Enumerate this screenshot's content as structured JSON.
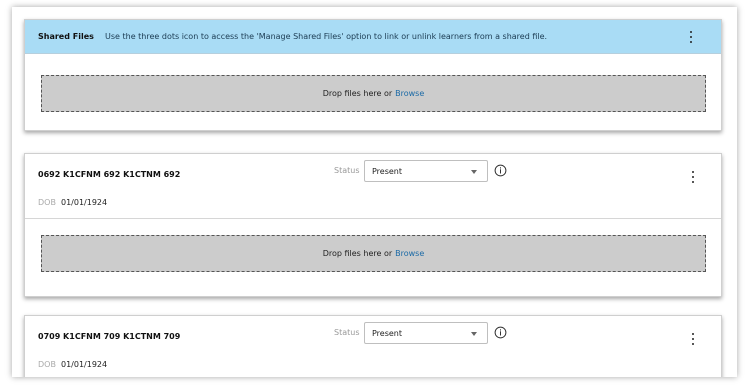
{
  "shared_files": {
    "title": "Shared Files",
    "info": "Use the three dots icon to access the 'Manage Shared Files' option to link or unlink learners from a shared file.",
    "drop_text": "Drop files here or",
    "browse_label": "Browse"
  },
  "learners": [
    {
      "name": "0692 K1CFNM 692 K1CTNM 692",
      "dob_label": "DOB",
      "dob": "01/01/1924",
      "status_label": "Status",
      "status": "Present",
      "drop_text": "Drop files here or",
      "browse_label": "Browse"
    },
    {
      "name": "0709 K1CFNM 709 K1CTNM 709",
      "dob_label": "DOB",
      "dob": "01/01/1924",
      "status_label": "Status",
      "status": "Present"
    }
  ],
  "icons": {
    "menu": "kebab-menu-icon",
    "info": "info-icon",
    "dropdown": "chevron-down-icon"
  },
  "colors": {
    "header_bg": "#a9dcf5",
    "dropzone_bg": "#cccccc",
    "link": "#1b6aa6"
  }
}
